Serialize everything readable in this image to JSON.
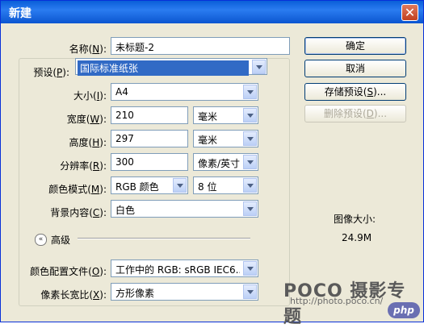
{
  "window": {
    "title": "新建",
    "close_glyph": "✕"
  },
  "fields": {
    "name": {
      "label_pre": "名称(",
      "key": "N",
      "label_post": "):",
      "value": "未标题-2"
    },
    "preset": {
      "label_pre": "预设(",
      "key": "P",
      "label_post": "):",
      "value": "国际标准纸张"
    },
    "size": {
      "label_pre": "大小(",
      "key": "I",
      "label_post": "):",
      "value": "A4"
    },
    "width": {
      "label_pre": "宽度(",
      "key": "W",
      "label_post": "):",
      "value": "210",
      "unit": "毫米"
    },
    "height": {
      "label_pre": "高度(",
      "key": "H",
      "label_post": "):",
      "value": "297",
      "unit": "毫米"
    },
    "resolution": {
      "label_pre": "分辨率(",
      "key": "R",
      "label_post": "):",
      "value": "300",
      "unit": "像素/英寸"
    },
    "color_mode": {
      "label_pre": "颜色模式(",
      "key": "M",
      "label_post": "):",
      "value": "RGB 颜色",
      "bits": "8 位"
    },
    "background": {
      "label_pre": "背景内容(",
      "key": "C",
      "label_post": "):",
      "value": "白色"
    },
    "advanced": {
      "label": "高级",
      "icon": "«"
    },
    "color_profile": {
      "label_pre": "颜色配置文件(",
      "key": "O",
      "label_post": "):",
      "value": "工作中的 RGB: sRGB IEC6..."
    },
    "pixel_aspect": {
      "label_pre": "像素长宽比(",
      "key": "X",
      "label_post": "):",
      "value": "方形像素"
    }
  },
  "buttons": {
    "ok": "确定",
    "cancel": "取消",
    "save_preset_pre": "存储预设(",
    "save_preset_key": "S",
    "save_preset_post": ")...",
    "delete_preset_pre": "删除预设(",
    "delete_preset_key": "D",
    "delete_preset_post": ")..."
  },
  "image_size": {
    "label": "图像大小:",
    "value": "24.9M"
  },
  "watermark": {
    "brand": "POCO 摄影专题",
    "url": "http://photo.poco.cn/",
    "badge": "php"
  }
}
